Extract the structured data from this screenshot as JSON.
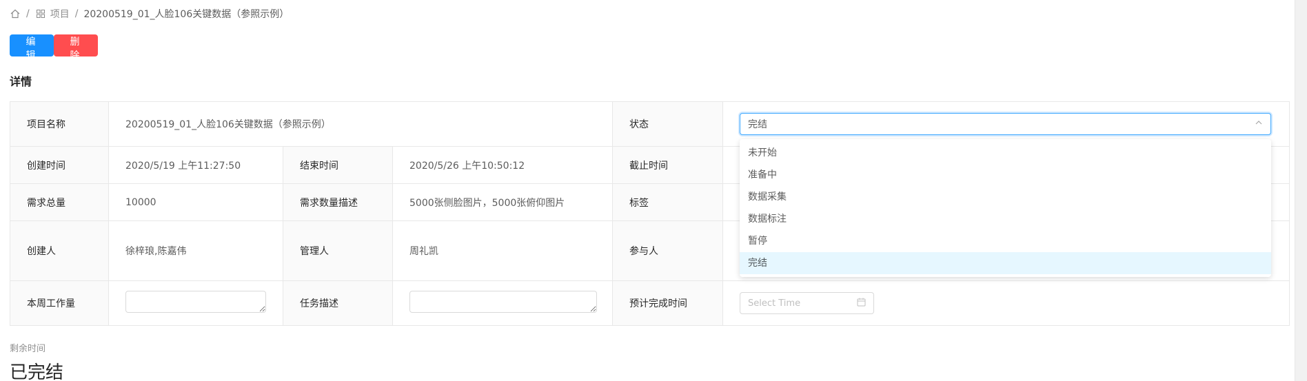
{
  "breadcrumb": {
    "project_label": "项目",
    "current": "20200519_01_人脸106关键数据（参照示例）",
    "separator": "/"
  },
  "actions": {
    "edit_label": "编 辑",
    "delete_label": "删 除"
  },
  "section_title": "详情",
  "details": {
    "project_name_label": "项目名称",
    "project_name_value": "20200519_01_人脸106关键数据（参照示例）",
    "status_label": "状态",
    "status_value": "完结",
    "created_time_label": "创建时间",
    "created_time_value": "2020/5/19 上午11:27:50",
    "end_time_label": "结束时间",
    "end_time_value": "2020/5/26 上午10:50:12",
    "deadline_label": "截止时间",
    "demand_total_label": "需求总量",
    "demand_total_value": "10000",
    "demand_desc_label": "需求数量描述",
    "demand_desc_value": "5000张侧脸图片，5000张俯仰图片",
    "tag_label": "标签",
    "creator_label": "创建人",
    "creator_value": "徐梓琅,陈嘉伟",
    "manager_label": "管理人",
    "manager_value": "周礼凯",
    "participant_label": "参与人",
    "weekly_work_label": "本周工作量",
    "task_desc_label": "任务描述",
    "eta_label": "预计完成时间",
    "time_placeholder": "Select Time"
  },
  "status_options": [
    {
      "label": "未开始",
      "selected": false
    },
    {
      "label": "准备中",
      "selected": false
    },
    {
      "label": "数据采集",
      "selected": false
    },
    {
      "label": "数据标注",
      "selected": false
    },
    {
      "label": "暂停",
      "selected": false
    },
    {
      "label": "完结",
      "selected": true
    }
  ],
  "remaining": {
    "label": "剩余时间",
    "value": "已完结"
  },
  "colors": {
    "primary": "#1890ff",
    "danger": "#ff4d4f",
    "selected_bg": "#e6f7ff"
  }
}
